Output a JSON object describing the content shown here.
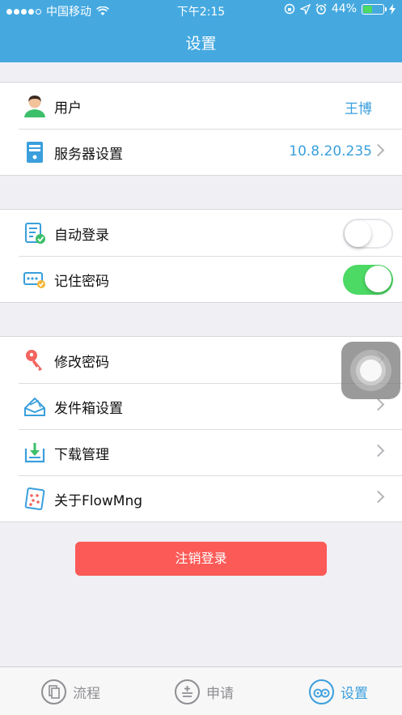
{
  "status_bar": {
    "carrier": "中国移动",
    "time": "下午2:15",
    "battery": "44%",
    "battery_level": 0.44,
    "signal_bars": 4
  },
  "header": {
    "title": "设置"
  },
  "groups": {
    "account": {
      "user": {
        "label": "用户",
        "value": "王博",
        "icon": "user-avatar-icon"
      },
      "server": {
        "label": "服务器设置",
        "value": "10.8.20.235",
        "icon": "server-icon"
      }
    },
    "login": {
      "auto_login": {
        "label": "自动登录",
        "enabled": false,
        "icon": "auto-login-icon"
      },
      "remember_password": {
        "label": "记住密码",
        "enabled": true,
        "icon": "password-card-icon"
      }
    },
    "misc": {
      "change_password": {
        "label": "修改密码",
        "icon": "key-icon"
      },
      "outbox": {
        "label": "发件箱设置",
        "icon": "outbox-icon"
      },
      "downloads": {
        "label": "下载管理",
        "icon": "download-icon"
      },
      "about": {
        "label": "关于FlowMng",
        "icon": "about-app-icon"
      }
    }
  },
  "logout_button": {
    "label": "注销登录",
    "color": "#fb5a57"
  },
  "tabbar": {
    "tabs": [
      {
        "label": "流程",
        "icon": "flow-document-icon",
        "active": false
      },
      {
        "label": "申请",
        "icon": "apply-add-icon",
        "active": false
      },
      {
        "label": "设置",
        "icon": "settings-gears-icon",
        "active": true
      }
    ]
  },
  "colors": {
    "accent": "#3a9fdc",
    "header": "#45a9e0",
    "toggle_on": "#4cd964"
  }
}
